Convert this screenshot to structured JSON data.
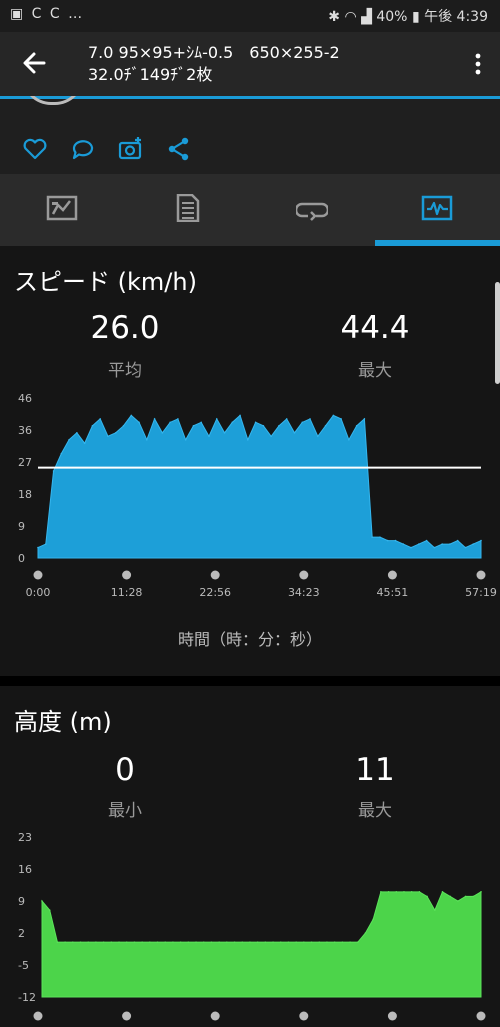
{
  "status_bar": {
    "left_icons": "▣ C C …",
    "battery": "40%",
    "time": "午後 4:39"
  },
  "app_bar": {
    "title_line1": "7.0 95×95+ｼﾑ-0.5　650×255-2",
    "title_line2": "32.0ﾁﾞ149ﾁﾞ2枚"
  },
  "tabs": [
    {
      "label": "overview"
    },
    {
      "label": "details"
    },
    {
      "label": "laps"
    },
    {
      "label": "charts"
    }
  ],
  "speed": {
    "heading": "スピード (km/h)",
    "avg_value": "26.0",
    "avg_label": "平均",
    "max_value": "44.4",
    "max_label": "最大",
    "axis_title": "時間（時：分：秒）"
  },
  "elevation": {
    "heading": "高度 (m)",
    "min_value": "0",
    "min_label": "最小",
    "max_value": "11",
    "max_label": "最大"
  },
  "colors": {
    "accent": "#1a9bd7",
    "speed_fill": "#1d9fd8",
    "elev_fill": "#4cd44a"
  },
  "chart_data": [
    {
      "type": "area",
      "title": "スピード (km/h)",
      "xlabel": "時間（時：分：秒）",
      "x_ticks": [
        "0:00",
        "11:28",
        "22:56",
        "34:23",
        "45:51",
        "57:19"
      ],
      "y_ticks": [
        "46",
        "36",
        "27",
        "18",
        "9",
        "0"
      ],
      "ylim": [
        0,
        46
      ],
      "average_line": 26,
      "series": [
        {
          "x_min": [
            0,
            1,
            2,
            3,
            4,
            5,
            6,
            7,
            8,
            9,
            10,
            11,
            12,
            13,
            14,
            15,
            16,
            17,
            18,
            19,
            20,
            21,
            22,
            23,
            24,
            25,
            26,
            27,
            28,
            29,
            30,
            31,
            32,
            33,
            34,
            35,
            36,
            37,
            38,
            39,
            40,
            41,
            42,
            43,
            44,
            45,
            46,
            47,
            48,
            49,
            50,
            51,
            52,
            53,
            54,
            55,
            56,
            57
          ],
          "values": [
            3,
            4,
            25,
            30,
            34,
            36,
            33,
            38,
            40,
            35,
            36,
            38,
            41,
            39,
            34,
            40,
            36,
            39,
            40,
            34,
            38,
            39,
            35,
            40,
            36,
            39,
            41,
            34,
            39,
            38,
            35,
            38,
            40,
            36,
            39,
            40,
            35,
            38,
            41,
            40,
            34,
            38,
            40,
            6,
            6,
            5,
            5,
            4,
            3,
            4,
            5,
            3,
            4,
            4,
            5,
            3,
            4,
            5
          ]
        }
      ]
    },
    {
      "type": "area",
      "title": "高度 (m)",
      "y_ticks": [
        "23",
        "16",
        "9",
        "2",
        "-5",
        "-12"
      ],
      "ylim": [
        -12,
        23
      ],
      "series": [
        {
          "x_min": [
            0,
            1,
            2,
            3,
            4,
            5,
            6,
            7,
            8,
            9,
            10,
            11,
            12,
            13,
            14,
            15,
            16,
            17,
            18,
            19,
            20,
            21,
            22,
            23,
            24,
            25,
            26,
            27,
            28,
            29,
            30,
            31,
            32,
            33,
            34,
            35,
            36,
            37,
            38,
            39,
            40,
            41,
            42,
            43,
            44,
            45,
            46,
            47,
            48,
            49,
            50,
            51,
            52,
            53,
            54,
            55,
            56,
            57
          ],
          "values": [
            9,
            7,
            0,
            0,
            0,
            0,
            0,
            0,
            0,
            0,
            0,
            0,
            0,
            0,
            0,
            0,
            0,
            0,
            0,
            0,
            0,
            0,
            0,
            0,
            0,
            0,
            0,
            0,
            0,
            0,
            0,
            0,
            0,
            0,
            0,
            0,
            0,
            0,
            0,
            0,
            0,
            0,
            2,
            5,
            11,
            11,
            11,
            11,
            11,
            11,
            10,
            7,
            11,
            10,
            9,
            10,
            10,
            11
          ]
        }
      ]
    }
  ]
}
